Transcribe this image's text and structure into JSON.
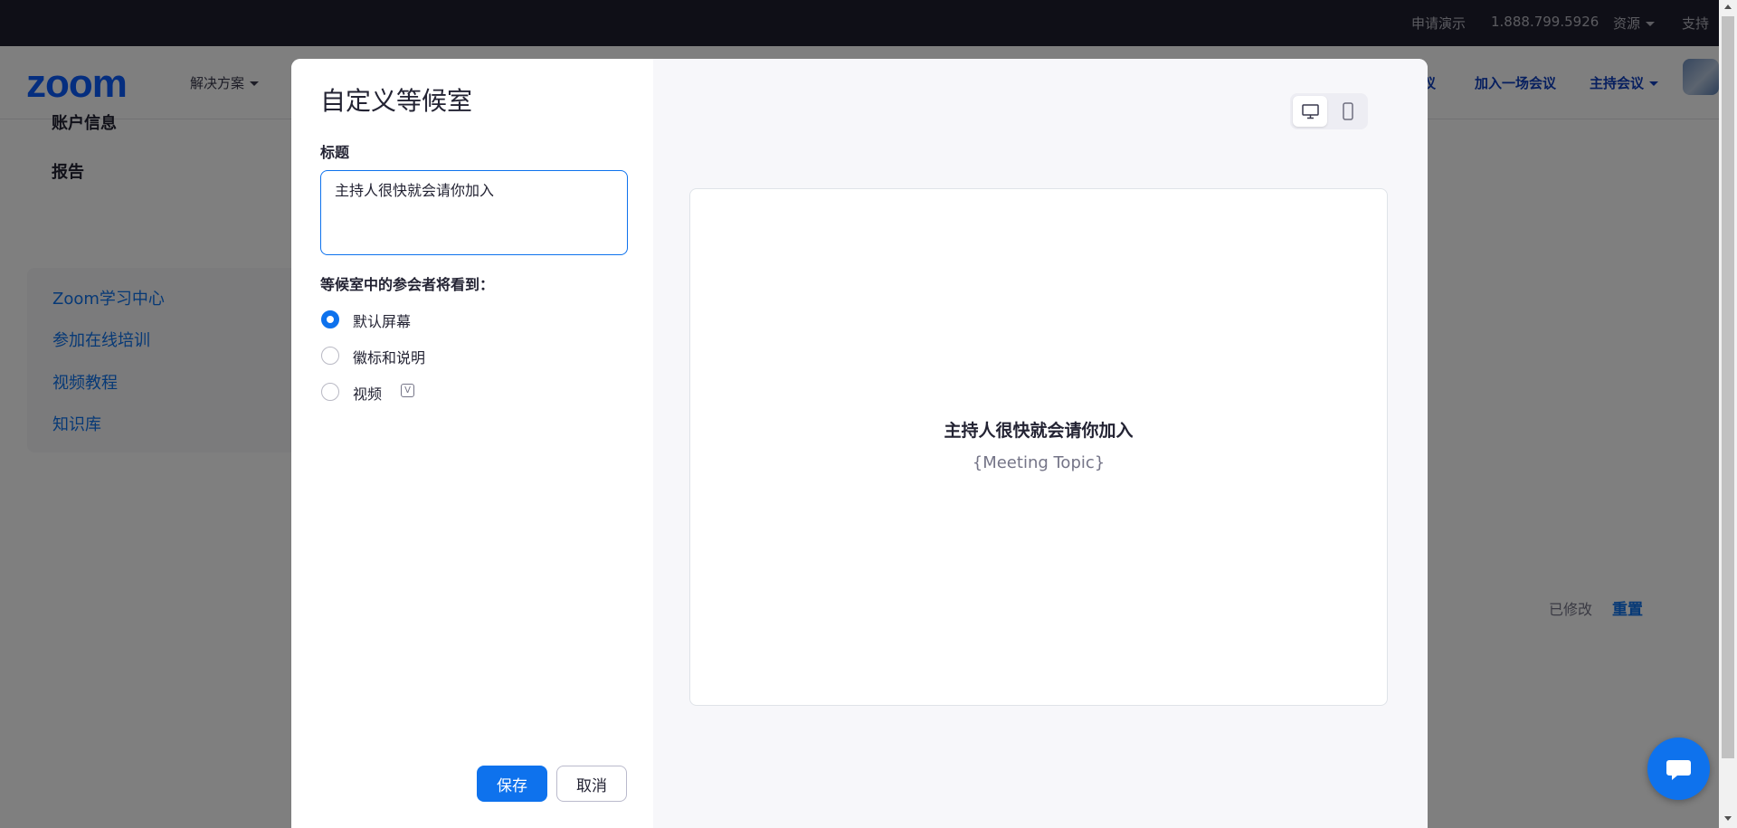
{
  "topbar": {
    "request_demo": "申请演示",
    "phone": "1.888.799.5926",
    "resources": "资源",
    "support": "支持"
  },
  "navbar": {
    "logo": "zoom",
    "solutions": "解决方案",
    "schedule_partial": "议",
    "join_meeting": "加入一场会议",
    "host_meeting": "主持会议"
  },
  "sidebar": {
    "account_info": "账户信息",
    "reports": "报告",
    "learning_links": [
      "Zoom学习中心",
      "参加在线培训",
      "视频教程",
      "知识库"
    ]
  },
  "settings": {
    "modified": "已修改",
    "reset": "重置"
  },
  "modal": {
    "title": "自定义等候室",
    "title_label": "标题",
    "title_value": "主持人很快就会请你加入",
    "see_label": "等候室中的参会者将看到：",
    "options": [
      {
        "label": "默认屏幕",
        "checked": true
      },
      {
        "label": "徽标和说明",
        "checked": false
      },
      {
        "label": "视频",
        "checked": false
      }
    ],
    "video_badge": "V",
    "save": "保存",
    "cancel": "取消",
    "preview": {
      "title": "主持人很快就会请你加入",
      "topic": "{Meeting Topic}",
      "device_selected": "desktop"
    }
  },
  "icons": {
    "desktop": "desktop-icon",
    "mobile": "mobile-icon",
    "chat": "chat-bubble-icon"
  },
  "colors": {
    "accent": "#0e72ed",
    "topbar_bg": "#1f1f2e",
    "logo": "#0b5cff"
  }
}
